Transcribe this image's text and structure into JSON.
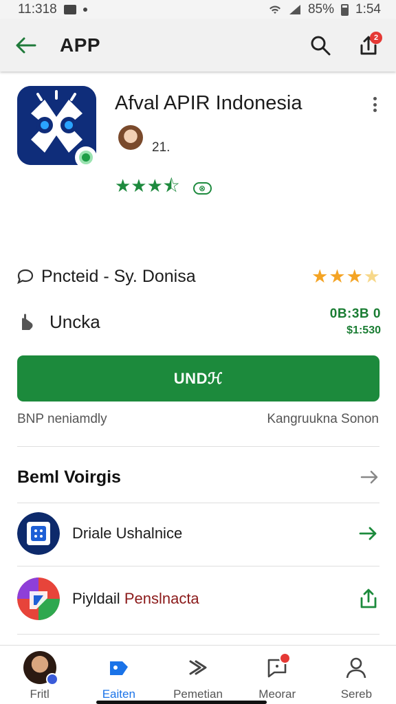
{
  "status_bar": {
    "time": "11:318",
    "battery": "85%",
    "clock_right": "1:54"
  },
  "app_bar": {
    "title": "APP"
  },
  "app": {
    "name": "Afval APIR Indonesia",
    "developer_count": "21.",
    "rating_stars": 3.5,
    "rating_stars_text": "★★★⯪",
    "rating_chip": "⊗"
  },
  "info": {
    "provider_label": "Pnctеid - Sy. Donisa",
    "provider_stars": "★★★",
    "provider_stars_half": "★",
    "download_label": "Uncka",
    "price_main": "0B:3B 0",
    "price_sub": "$1:530"
  },
  "install": {
    "button_label": "UNDℋ",
    "sub_left": "BNP neniamdly",
    "sub_right": "Kangruukna Sonon"
  },
  "section": {
    "title": "Beml Voirgis"
  },
  "list": [
    {
      "label": "Driale Ushalnice",
      "label_accent": ""
    },
    {
      "label": "Piyldail ",
      "label_accent": "Penslnacta"
    }
  ],
  "bottom_nav": [
    {
      "label": "Fritl"
    },
    {
      "label": "Eaiten"
    },
    {
      "label": "Pemetian"
    },
    {
      "label": "Meorar"
    },
    {
      "label": "Sereb"
    }
  ],
  "colors": {
    "accent_green": "#1c8a3c",
    "star_orange": "#f4a425",
    "active_blue": "#1a73e8",
    "badge_red": "#e53935"
  }
}
